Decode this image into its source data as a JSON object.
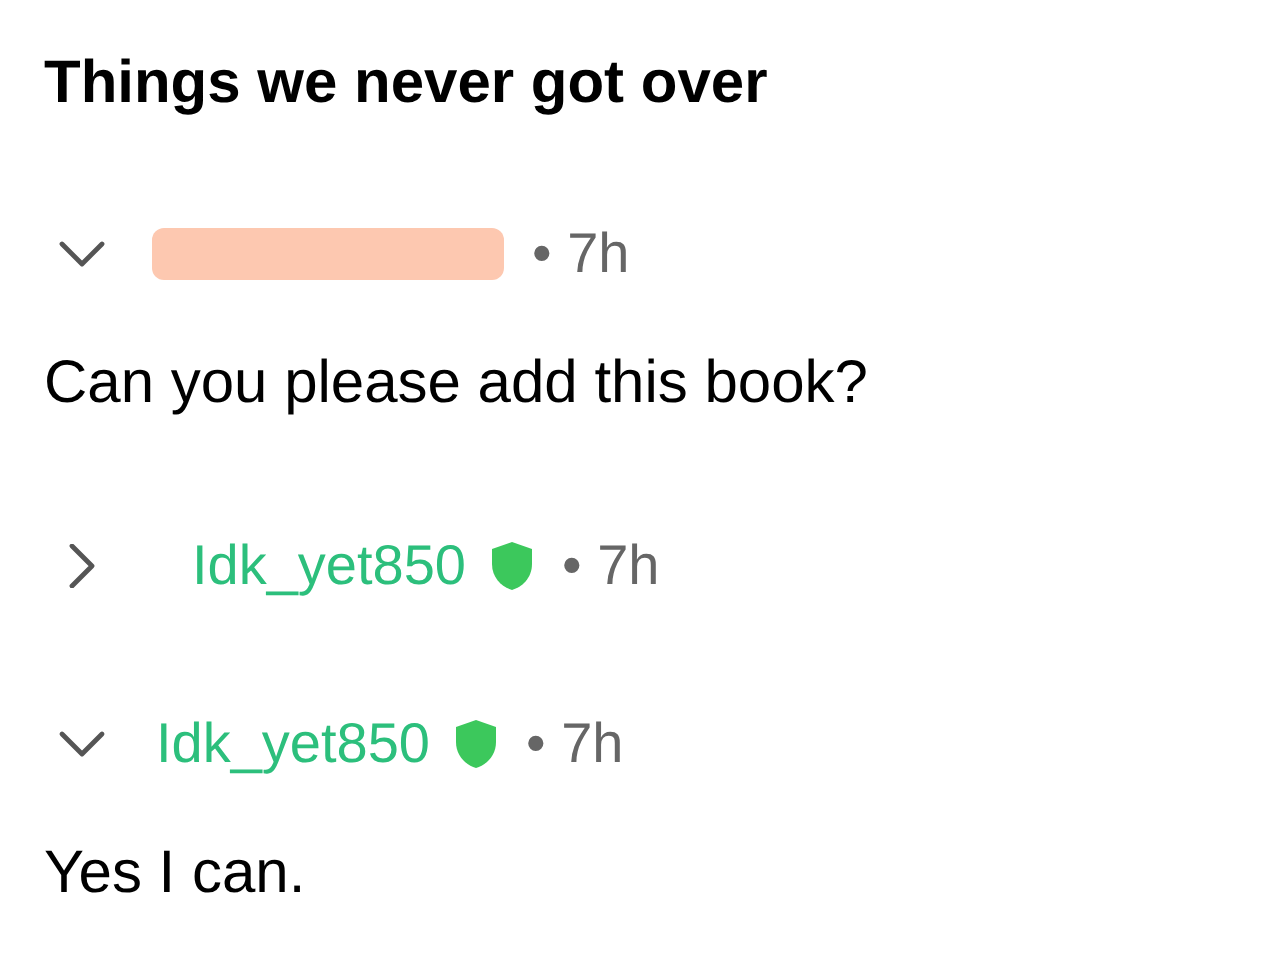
{
  "title": "Things we never got over",
  "comments": [
    {
      "time": "• 7h",
      "expanded": true,
      "body": "Can you please add this book?",
      "replies": [
        {
          "author": "Idk_yet850",
          "time": "• 7h",
          "expanded": false,
          "badge": true
        }
      ]
    },
    {
      "author": "Idk_yet850",
      "time": "• 7h",
      "expanded": true,
      "badge": true,
      "body": "Yes I can."
    }
  ]
}
